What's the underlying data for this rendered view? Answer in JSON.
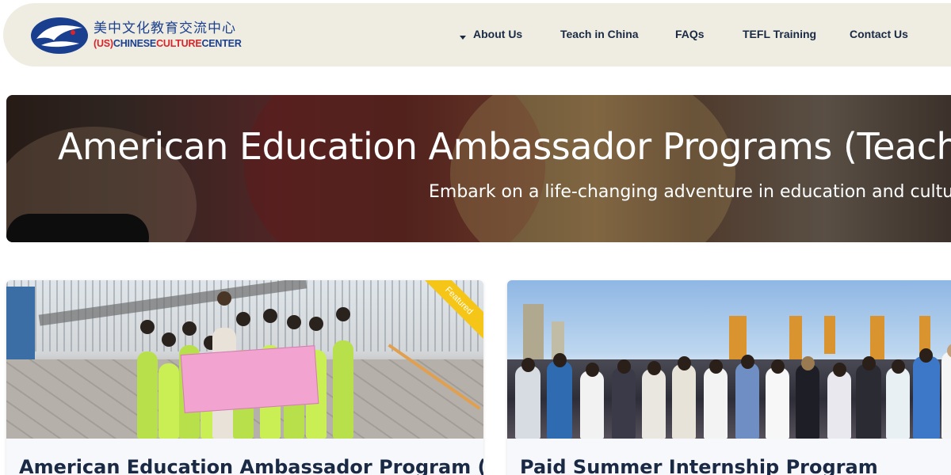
{
  "header": {
    "logo": {
      "chinese": "美中文化教育交流中心",
      "english_us": "(US)",
      "english_chinese": "CHINESE",
      "english_culture": "CULTURE",
      "english_center": "CENTER"
    },
    "nav": [
      {
        "label": "About Us",
        "has_dropdown": true
      },
      {
        "label": "Teach in China"
      },
      {
        "label": "FAQs"
      },
      {
        "label": "TEFL Training"
      },
      {
        "label": "Contact Us"
      }
    ]
  },
  "hero": {
    "title": "American Education Ambassador Programs (Teach in",
    "subtitle": "Embark on a life-changing adventure in education and cultu"
  },
  "cards": [
    {
      "title": "American Education Ambassador Program (Teach in",
      "badge": "Featured"
    },
    {
      "title": "Paid Summer Internship Program"
    }
  ],
  "colors": {
    "header_bg": "#efede2",
    "logo_blue": "#1b3f8f",
    "logo_red": "#d8242b",
    "text_dark": "#1a2a44",
    "badge": "#f5c518"
  }
}
